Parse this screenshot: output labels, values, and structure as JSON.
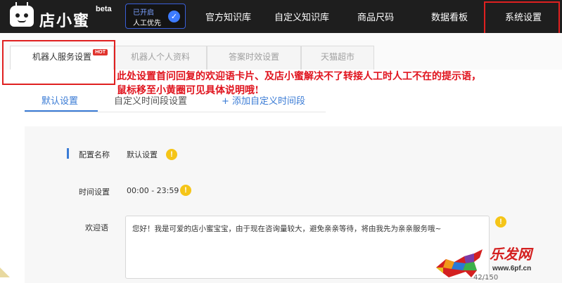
{
  "header": {
    "logo_text": "店小蜜",
    "logo_beta": "beta",
    "ai_badge_line1": "已开启",
    "ai_badge_line2": "人工优先",
    "nav": [
      "官方知识库",
      "自定义知识库",
      "商品尺码",
      "数据看板",
      "系统设置"
    ]
  },
  "tabs": [
    "机器人服务设置",
    "机器人个人资料",
    "答案时效设置",
    "天猫超市"
  ],
  "hot_badge": "HOT",
  "annotation_line1": "此处设置首问回复的欢迎语卡片、及店小蜜解决不了转接人工时人工不在的提示语，",
  "annotation_line2": "鼠标移至小黄圈可见具体说明哦!",
  "subtabs": {
    "default": "默认设置",
    "custom": "自定义时间段设置",
    "add": "+ 添加自定义时间段"
  },
  "form": {
    "config_name_label": "配置名称",
    "config_name_value": "默认设置",
    "time_label": "时间设置",
    "time_value": "00:00 - 23:59",
    "welcome_label": "欢迎语",
    "welcome_text": "您好！我是可爱的店小蜜宝宝，由于现在咨询量较大，避免亲亲等待，将由我先为亲亲服务哦~",
    "counter": "42/150"
  },
  "watermark": {
    "title": "乐发网",
    "url": "www.6pf.cn"
  },
  "colors": {
    "nav_bg": "#1e1e1e",
    "accent_blue": "#3a7bd5",
    "warning_yellow": "#f5c518",
    "annotation_red": "#e0141e"
  }
}
